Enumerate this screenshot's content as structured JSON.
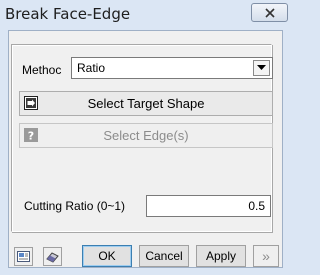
{
  "window": {
    "title": "Break Face-Edge",
    "close_icon": "close-icon"
  },
  "method": {
    "label": "Methoc",
    "value": "Ratio"
  },
  "buttons": {
    "select_target_shape": "Select Target Shape",
    "select_edges": "Select Edge(s)",
    "select_edges_enabled": false
  },
  "cutting_ratio": {
    "label": "Cutting Ratio (0~1)",
    "value": "0.5"
  },
  "footer": {
    "ok": "OK",
    "cancel": "Cancel",
    "apply": "Apply",
    "expand": "»",
    "tool_icons": [
      "preview-icon",
      "eraser-icon"
    ]
  }
}
